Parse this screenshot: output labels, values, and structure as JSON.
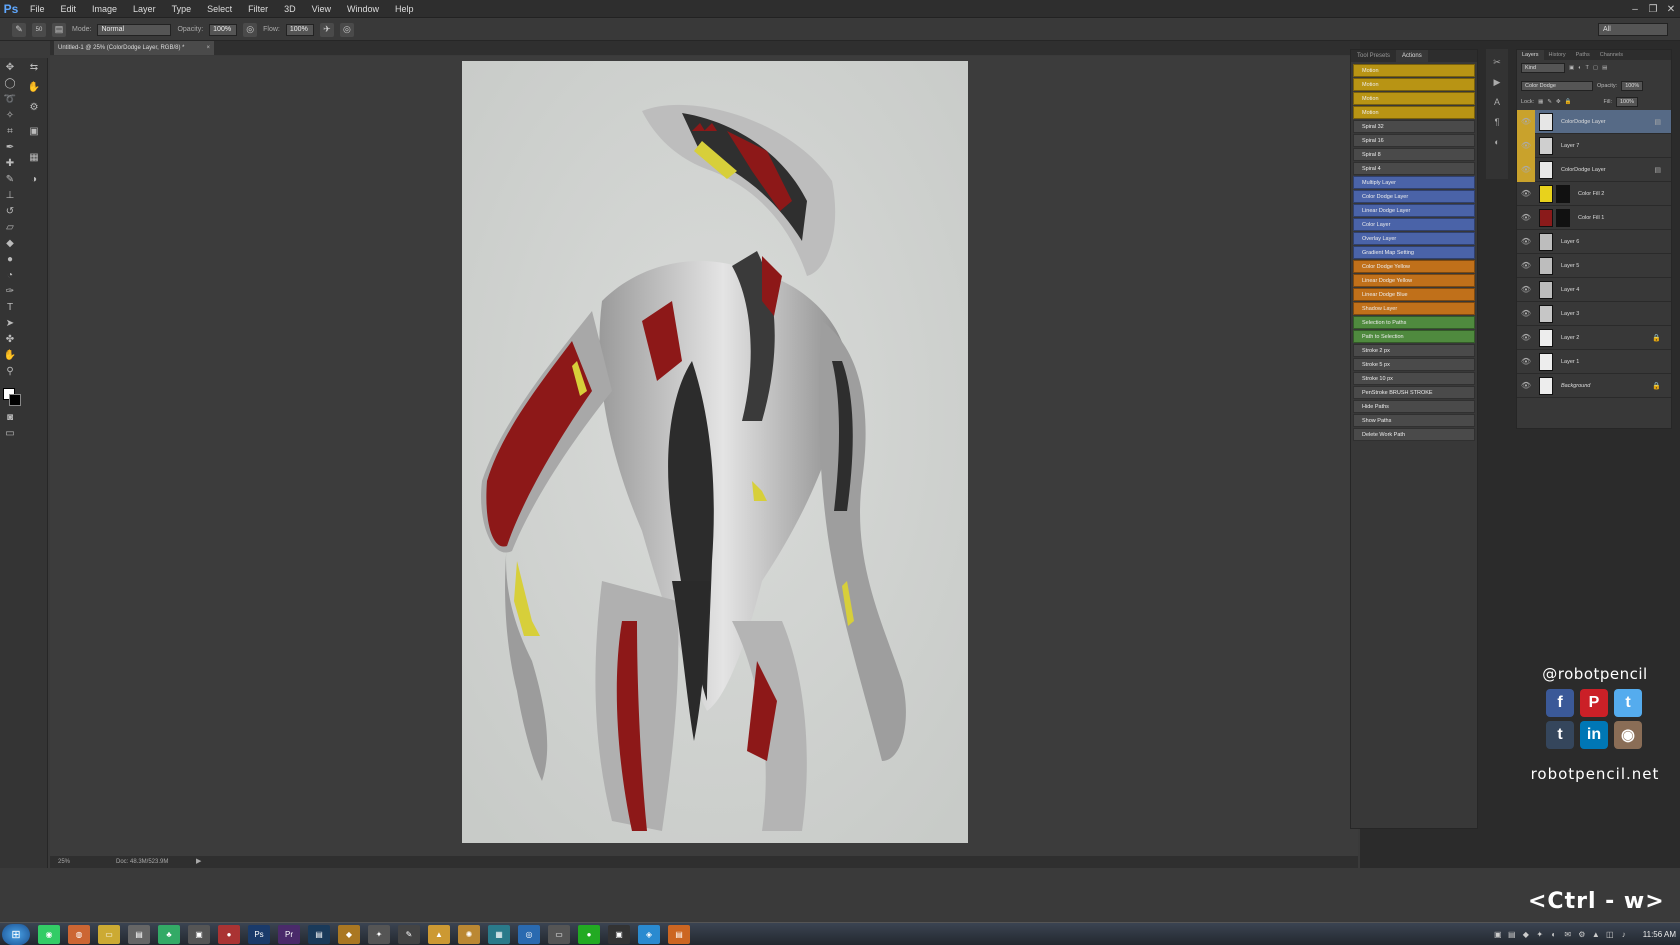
{
  "app": {
    "logo": "Ps"
  },
  "menu": [
    "File",
    "Edit",
    "Image",
    "Layer",
    "Type",
    "Select",
    "Filter",
    "3D",
    "View",
    "Window",
    "Help"
  ],
  "options": {
    "mode_label": "Mode:",
    "mode_value": "Normal",
    "opacity_label": "Opacity:",
    "opacity_value": "100%",
    "flow_label": "Flow:",
    "flow_value": "100%",
    "brush_size": "50",
    "workspace": "All"
  },
  "document": {
    "tab_title": "Untitled-1 @ 25% (ColorDodge Layer, RGB/8) *",
    "zoom": "25%",
    "doc_size": "Doc: 48.3M/523.9M"
  },
  "actions_panel": {
    "tabs": [
      "Tool Presets",
      "Actions"
    ],
    "items": [
      {
        "label": "Motion",
        "color": "#b89414"
      },
      {
        "label": "Motion",
        "color": "#b89414"
      },
      {
        "label": "Motion",
        "color": "#b89414"
      },
      {
        "label": "Motion",
        "color": "#b89414"
      },
      {
        "label": "Spiral 32",
        "color": "#4a4a4a"
      },
      {
        "label": "Spiral 16",
        "color": "#4a4a4a"
      },
      {
        "label": "Spiral 8",
        "color": "#4a4a4a"
      },
      {
        "label": "Spiral 4",
        "color": "#4a4a4a"
      },
      {
        "label": "Multiply Layer",
        "color": "#4a63a8"
      },
      {
        "label": "Color Dodge Layer",
        "color": "#4a63a8"
      },
      {
        "label": "Linear Dodge Layer",
        "color": "#4a63a8"
      },
      {
        "label": "Color Layer",
        "color": "#4a63a8"
      },
      {
        "label": "Overlay Layer",
        "color": "#4a63a8"
      },
      {
        "label": "Gradient Map Setting",
        "color": "#4a63a8"
      },
      {
        "label": "Color Dodge Yellow",
        "color": "#c0701a"
      },
      {
        "label": "Linear Dodge Yellow",
        "color": "#c0701a"
      },
      {
        "label": "Linear Dodge Blue",
        "color": "#c0701a"
      },
      {
        "label": "Shadow Layer",
        "color": "#c0701a"
      },
      {
        "label": "Selection to Paths",
        "color": "#4f8a3e"
      },
      {
        "label": "Path to Selection",
        "color": "#4f8a3e"
      },
      {
        "label": "Stroke 2 px",
        "color": "#4a4a4a"
      },
      {
        "label": "Stroke 5 px",
        "color": "#4a4a4a"
      },
      {
        "label": "Stroke 10 px",
        "color": "#4a4a4a"
      },
      {
        "label": "PenStroke BRUSH STROKE",
        "color": "#4a4a4a"
      },
      {
        "label": "Hide Paths",
        "color": "#4a4a4a"
      },
      {
        "label": "Show Paths",
        "color": "#4a4a4a"
      },
      {
        "label": "Delete Work Path",
        "color": "#4a4a4a"
      }
    ]
  },
  "layers_panel": {
    "tabs": [
      "Layers",
      "History",
      "Paths",
      "Channels"
    ],
    "kind": "Kind",
    "blend_mode": "Color Dodge",
    "opacity_label": "Opacity:",
    "opacity_value": "100%",
    "lock_label": "Lock:",
    "fill_label": "Fill:",
    "fill_value": "100%",
    "layers": [
      {
        "name": "ColorDodge Layer",
        "thumb": "#e6e6e6",
        "selected": true,
        "has_mask": false,
        "lock": "",
        "badge": "▤",
        "eye_color": "#c9a22c"
      },
      {
        "name": "Layer 7",
        "thumb": "#cfcfcf",
        "selected": false,
        "has_mask": false,
        "lock": "",
        "badge": "",
        "eye_color": "#c9a22c"
      },
      {
        "name": "ColorDodge Layer",
        "thumb": "#e6e6e6",
        "selected": false,
        "has_mask": false,
        "lock": "",
        "badge": "▤",
        "eye_color": "#c9a22c"
      },
      {
        "name": "Color Fill 2",
        "thumb": "#e8d21c",
        "selected": false,
        "has_mask": true,
        "lock": "",
        "badge": "",
        "eye_color": ""
      },
      {
        "name": "Color Fill 1",
        "thumb": "#8a1a1a",
        "selected": false,
        "has_mask": true,
        "lock": "",
        "badge": "",
        "eye_color": ""
      },
      {
        "name": "Layer 6",
        "thumb": "#bdbdbd",
        "selected": false,
        "has_mask": false,
        "lock": "",
        "badge": "",
        "eye_color": ""
      },
      {
        "name": "Layer 5",
        "thumb": "#bdbdbd",
        "selected": false,
        "has_mask": false,
        "lock": "",
        "badge": "",
        "eye_color": ""
      },
      {
        "name": "Layer 4",
        "thumb": "#bdbdbd",
        "selected": false,
        "has_mask": false,
        "lock": "",
        "badge": "",
        "eye_color": ""
      },
      {
        "name": "Layer 3",
        "thumb": "#c6c6c6",
        "selected": false,
        "has_mask": false,
        "lock": "",
        "badge": "",
        "eye_color": ""
      },
      {
        "name": "Layer 2",
        "thumb": "#ededed",
        "selected": false,
        "has_mask": false,
        "lock": "🔒",
        "badge": "",
        "eye_color": ""
      },
      {
        "name": "Layer 1",
        "thumb": "#ededed",
        "selected": false,
        "has_mask": false,
        "lock": "",
        "badge": "",
        "eye_color": ""
      },
      {
        "name": "Background",
        "thumb": "#ededed",
        "selected": false,
        "has_mask": false,
        "lock": "🔒",
        "badge": "",
        "eye_color": ""
      }
    ]
  },
  "branding": {
    "handle": "@robotpencil",
    "url": "robotpencil.net",
    "shortcut": "<Ctrl - w>",
    "social": [
      {
        "icon": "facebook-icon",
        "glyph": "f",
        "color": "#3b5998"
      },
      {
        "icon": "pinterest-icon",
        "glyph": "P",
        "color": "#cb2027"
      },
      {
        "icon": "twitter-icon",
        "glyph": "t",
        "color": "#55acee"
      },
      {
        "icon": "tumblr-icon",
        "glyph": "t",
        "color": "#35465c"
      },
      {
        "icon": "linkedin-icon",
        "glyph": "in",
        "color": "#0077b5"
      },
      {
        "icon": "instagram-icon",
        "glyph": "◉",
        "color": "#8a6d56"
      }
    ]
  },
  "taskbar": {
    "clock": "11:56 AM"
  }
}
